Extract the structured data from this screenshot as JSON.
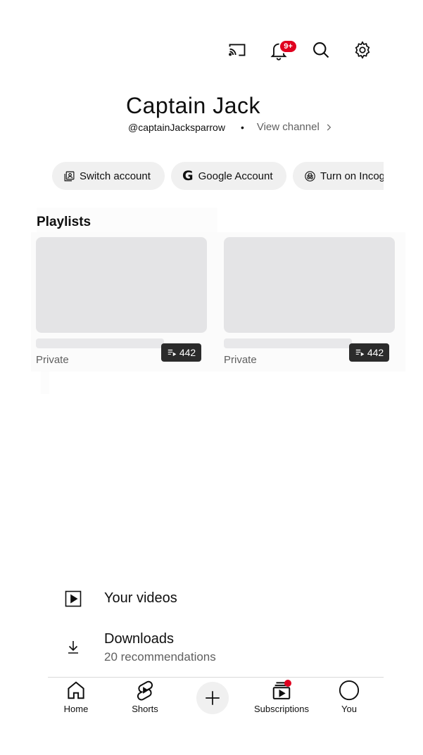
{
  "header": {
    "icons": [
      "cast-icon",
      "notifications-icon",
      "search-icon",
      "settings-icon"
    ],
    "notification_badge": "9+"
  },
  "channel": {
    "name": "Captain Jack",
    "handle": "@captainJacksparrow",
    "separator": "•",
    "view_channel": "View channel"
  },
  "chips": [
    {
      "label": "Switch account",
      "icon": "switch-account-icon"
    },
    {
      "label": "Google Account",
      "icon": "google-g-icon"
    },
    {
      "label": "Turn on Incognito",
      "icon": "incognito-icon"
    }
  ],
  "playlists": {
    "title": "Playlists",
    "items": [
      {
        "privacy": "Private",
        "count": "442"
      },
      {
        "privacy": "Private",
        "count": "442"
      }
    ]
  },
  "menu": [
    {
      "title": "Your videos",
      "subtitle": "",
      "icon": "play-square-icon"
    },
    {
      "title": "Downloads",
      "subtitle": "20 recommendations",
      "icon": "download-icon"
    }
  ],
  "bottom_nav": [
    {
      "label": "Home",
      "icon": "home-icon"
    },
    {
      "label": "Shorts",
      "icon": "shorts-icon"
    },
    {
      "label": "",
      "icon": "create-plus-icon"
    },
    {
      "label": "Subscriptions",
      "icon": "subscriptions-icon"
    },
    {
      "label": "You",
      "icon": "avatar-icon"
    }
  ],
  "colors": {
    "badge": "#e0001f",
    "chip_bg": "#f0f0f0",
    "placeholder": "#e4e4e6",
    "count_bg": "#2b2b2b"
  }
}
